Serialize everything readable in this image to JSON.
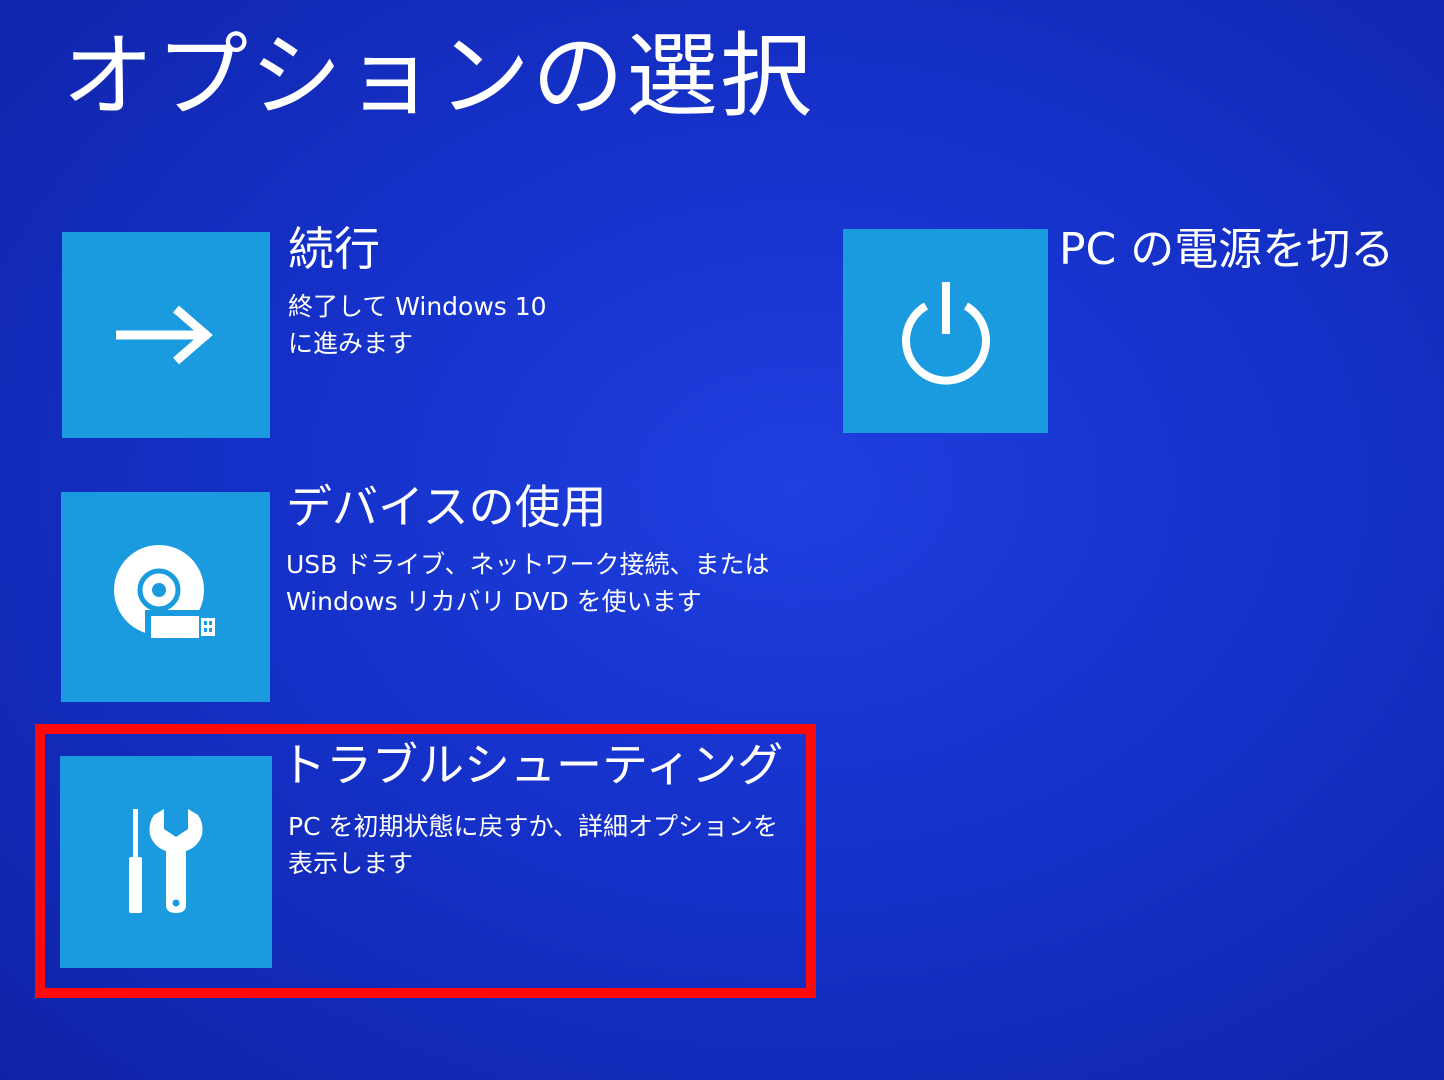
{
  "page": {
    "title": "オプションの選択"
  },
  "options": {
    "continue": {
      "icon": "arrow-right-icon",
      "title": "続行",
      "description": "終了して Windows 10\nに進みます"
    },
    "use_device": {
      "icon": "disc-usb-icon",
      "title": "デバイスの使用",
      "description": "USB ドライブ、ネットワーク接続、または\nWindows リカバリ DVD を使います"
    },
    "troubleshoot": {
      "icon": "screwdriver-wrench-icon",
      "title": "トラブルシューティング",
      "description": "PC を初期状態に戻すか、詳細オプションを\n表示します",
      "highlighted": true
    },
    "power_off": {
      "icon": "power-icon",
      "title": "PC の電源を切る"
    }
  },
  "colors": {
    "background": "#1531c9",
    "tile": "#1a9be0",
    "text": "#ffffff",
    "highlight_border": "#ff0a0a"
  }
}
